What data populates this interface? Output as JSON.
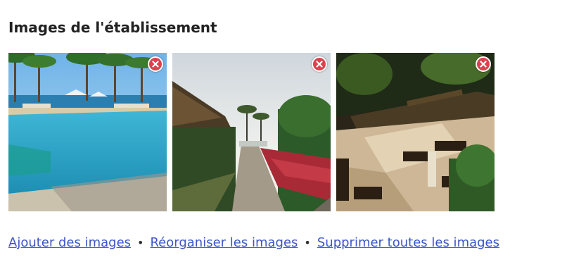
{
  "section": {
    "title": "Images de l'établissement"
  },
  "images": [
    {
      "alt": "pool-photo",
      "remove_icon": "close-circle-icon"
    },
    {
      "alt": "pathway-photo",
      "remove_icon": "close-circle-icon"
    },
    {
      "alt": "lobby-photo",
      "remove_icon": "close-circle-icon"
    }
  ],
  "actions": {
    "add_images": "Ajouter des images",
    "reorder_images": "Réorganiser les images",
    "delete_all_images": "Supprimer toutes les images",
    "separator": "•"
  },
  "colors": {
    "link": "#3c55c7",
    "remove_button": "#d9434e"
  }
}
